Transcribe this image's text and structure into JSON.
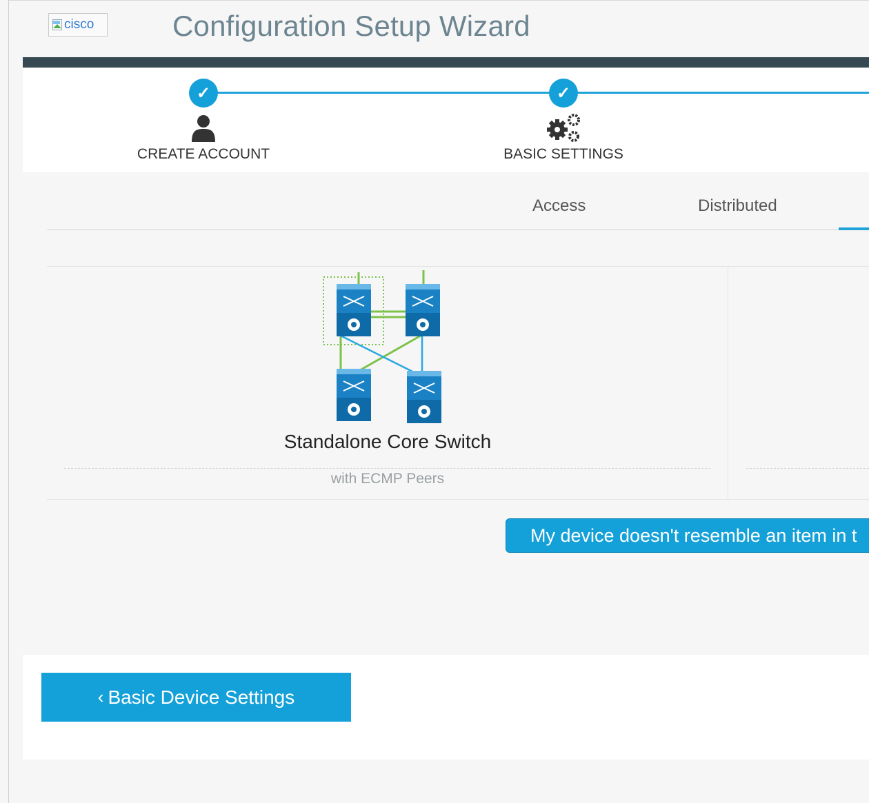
{
  "header": {
    "logo_alt": "cisco",
    "title": "Configuration Setup Wizard"
  },
  "wizard": {
    "steps": [
      {
        "label": "CREATE ACCOUNT",
        "status": "complete",
        "icon": "user-icon"
      },
      {
        "label": "BASIC SETTINGS",
        "status": "complete",
        "icon": "gears-icon"
      }
    ],
    "check_glyph": "✓"
  },
  "tabs": {
    "items": [
      "Access",
      "Distributed"
    ]
  },
  "cards": [
    {
      "title": "Standalone Core Switch",
      "subtitle": "with ECMP Peers",
      "icon": "core-switch-topology-icon"
    }
  ],
  "actions": {
    "no_match_label": "My device doesn't resemble an item in t",
    "back_label": "Basic Device Settings",
    "back_chevron": "‹"
  },
  "colors": {
    "accent": "#14a0d8",
    "header_bar": "#364953",
    "title_text": "#6c8591"
  }
}
